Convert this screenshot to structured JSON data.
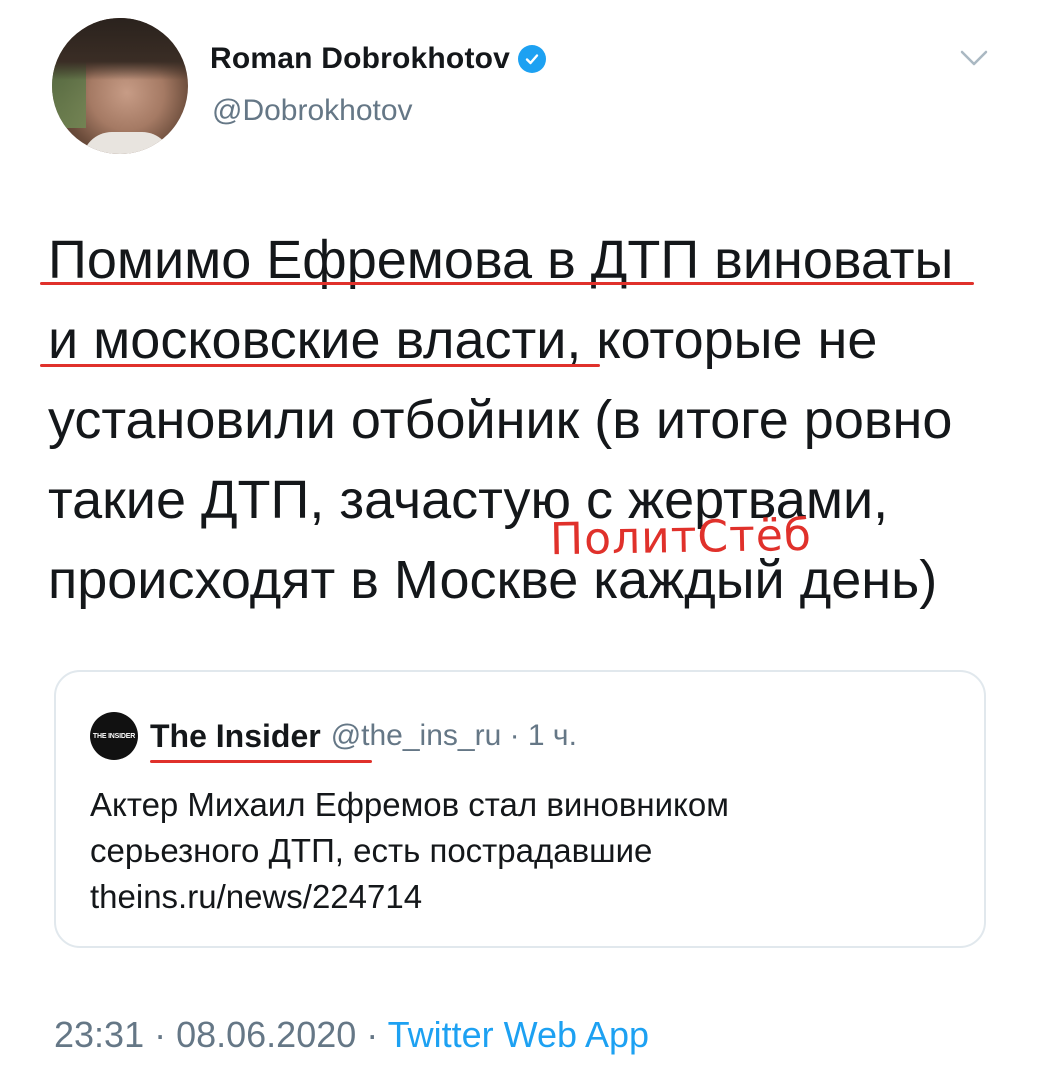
{
  "author": {
    "display_name": "Roman Dobrokhotov",
    "handle": "@Dobrokhotov"
  },
  "tweet": {
    "lines": [
      "Помимо Ефремова в ДТП виноваты",
      "и московские власти, которые не",
      "установили отбойник (в итоге ровно",
      "такие ДТП, зачастую с жертвами,",
      "происходят в Москве каждый день)"
    ]
  },
  "watermark": "ПолитСтёб",
  "quoted_tweet": {
    "logo_text": "THE INSIDER",
    "name": "The Insider",
    "meta": "@the_ins_ru · 1 ч.",
    "lines": [
      "Актер Михаил Ефремов стал виновником",
      "серьезного ДТП, есть пострадавшие",
      "theins.ru/news/224714"
    ]
  },
  "footer": {
    "time_date": "23:31 · 08.06.2020 · ",
    "app": "Twitter Web App"
  },
  "colors": {
    "link": "#1da1f2",
    "secondary_text": "#657786",
    "annotation_red": "#e0312b"
  },
  "icons": [
    "verified-badge-icon",
    "chevron-down-icon"
  ]
}
